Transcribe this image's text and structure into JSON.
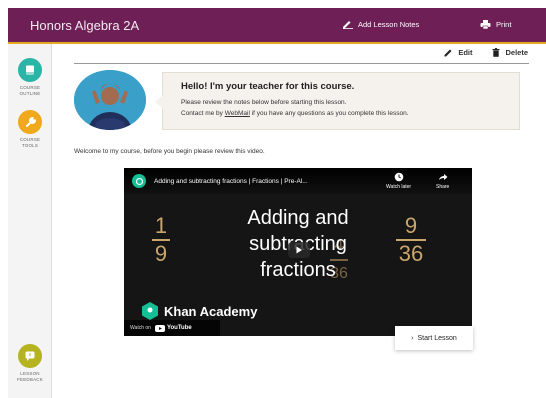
{
  "header": {
    "course_title": "Honors Algebra 2A",
    "add_notes_label": "Add Lesson Notes",
    "print_label": "Print",
    "bar_color": "#6e1f55",
    "accent_color": "#e6a81e"
  },
  "sidebar": {
    "items": [
      {
        "label_line1": "COURSE",
        "label_line2": "OUTLINE",
        "icon": "book-icon",
        "color": "#2bb5a7"
      },
      {
        "label_line1": "COURSE",
        "label_line2": "TOOLS",
        "icon": "wrench-icon",
        "color": "#f0a81c"
      },
      {
        "label_line1": "LESSON",
        "label_line2": "FEEDBACK",
        "icon": "feedback-icon",
        "color": "#b5b320"
      }
    ]
  },
  "toolbar": {
    "edit_label": "Edit",
    "delete_label": "Delete"
  },
  "intro": {
    "heading": "Hello! I'm your teacher for this course.",
    "line1": "Please review the notes below before starting this lesson.",
    "line2_prefix": "Contact me by",
    "line2_link": "WebMail",
    "line2_suffix": "if you have any questions as you complete this lesson."
  },
  "welcome_text": "Welcome to my course, before you begin please review this video.",
  "video": {
    "title": "Adding and subtracting fractions | Fractions | Pre-Al...",
    "watch_later_label": "Watch later",
    "share_label": "Share",
    "overlay_line1": "Adding and",
    "overlay_line2": "subtracting",
    "overlay_line3": "fractions",
    "frac_left_num": "1",
    "frac_left_den": "9",
    "frac_mid_num": "4",
    "frac_mid_den": "36",
    "frac_right_num": "9",
    "frac_right_den": "36",
    "brand_label": "Khan Academy",
    "watch_on_label": "Watch on",
    "youtube_label": "YouTube"
  },
  "footer": {
    "start_lesson_label": "Start Lesson"
  }
}
